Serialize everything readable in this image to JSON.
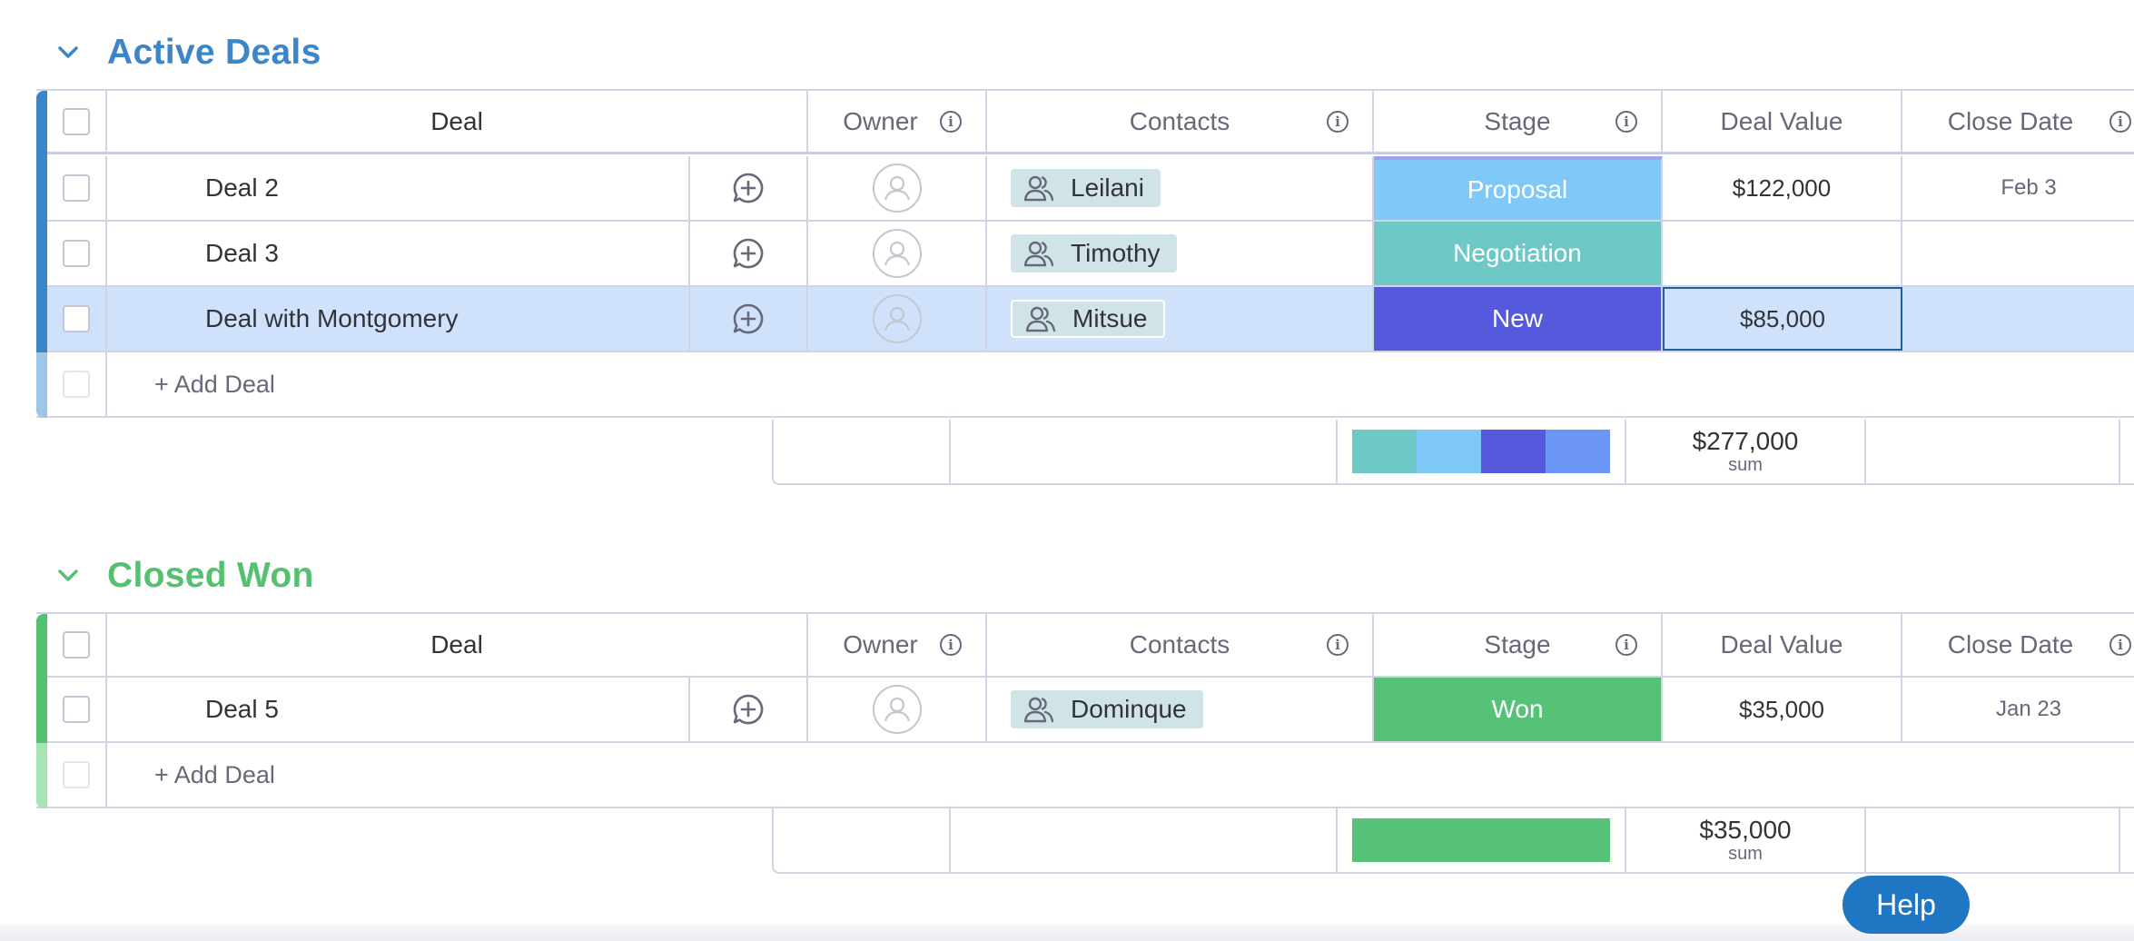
{
  "colors": {
    "active_group": "#3b86c8",
    "closed_group": "#55c06f",
    "stage_proposal": "#80c8f8",
    "stage_negotiation": "#6dc8c6",
    "stage_new": "#5559db",
    "stage_won": "#56c278",
    "selected_row": "#d0e2fb",
    "extra_segment": "#6b96f5"
  },
  "icons": {
    "collapse": "chevron-down-icon",
    "info": "info-icon",
    "update": "add-update-icon",
    "person": "person-icon",
    "contacts": "people-icon"
  },
  "columns": {
    "deal": "Deal",
    "owner": "Owner",
    "contacts": "Contacts",
    "stage": "Stage",
    "deal_value": "Deal Value",
    "close_date": "Close Date"
  },
  "groups": {
    "active": {
      "title": "Active Deals",
      "rows": [
        {
          "name": "Deal 2",
          "contact": "Leilani",
          "stage": "Proposal",
          "value": "$122,000",
          "close_date": "Feb 3"
        },
        {
          "name": "Deal 3",
          "contact": "Timothy",
          "stage": "Negotiation",
          "value": "",
          "close_date": ""
        },
        {
          "name": "Deal with Montgomery",
          "contact": "Mitsue",
          "stage": "New",
          "value": "$85,000",
          "close_date": ""
        }
      ],
      "add_label": "+ Add Deal",
      "sum_value": "$277,000",
      "sum_label": "sum"
    },
    "closed": {
      "title": "Closed Won",
      "rows": [
        {
          "name": "Deal 5",
          "contact": "Dominque",
          "stage": "Won",
          "value": "$35,000",
          "close_date": "Jan 23"
        }
      ],
      "add_label": "+ Add Deal",
      "sum_value": "$35,000",
      "sum_label": "sum"
    }
  },
  "help_label": "Help"
}
